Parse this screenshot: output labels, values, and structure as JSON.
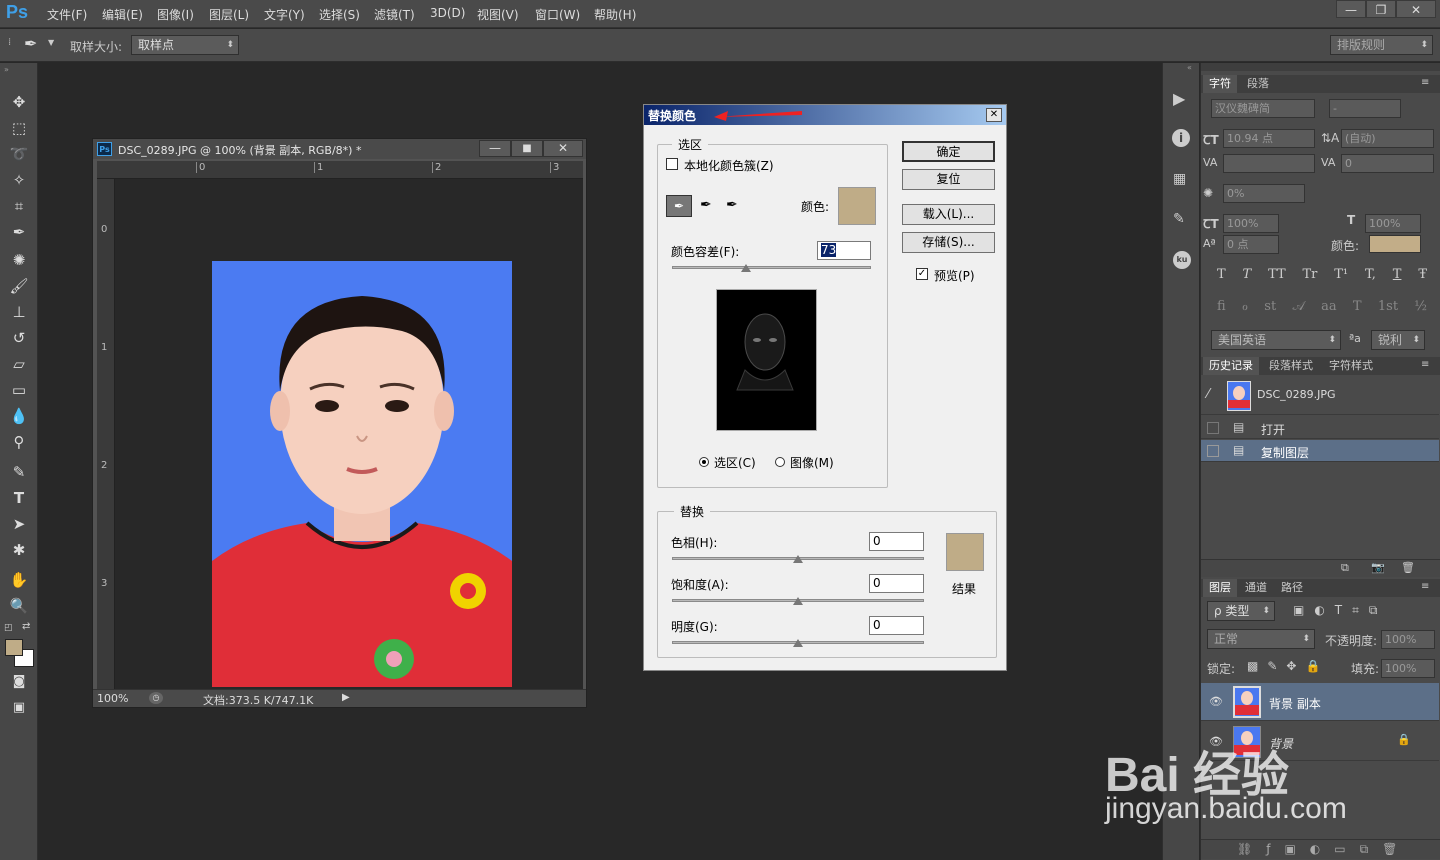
{
  "app": {
    "logo": "Ps"
  },
  "menu": [
    "文件(F)",
    "编辑(E)",
    "图像(I)",
    "图层(L)",
    "文字(Y)",
    "选择(S)",
    "滤镜(T)",
    "3D(D)",
    "视图(V)",
    "窗口(W)",
    "帮助(H)"
  ],
  "options": {
    "sample_size_label": "取样大小:",
    "sample_size_value": "取样点",
    "workspace": "排版规则"
  },
  "document": {
    "title": "DSC_0289.JPG @ 100% (背景 副本, RGB/8*) *",
    "zoom": "100%",
    "doc_info": "文档:373.5 K/747.1K",
    "ruler_h": [
      "0",
      "1",
      "2",
      "3"
    ],
    "ruler_v": [
      "0",
      "1",
      "2",
      "3"
    ]
  },
  "dialog": {
    "title": "替换颜色",
    "close": "✕",
    "selection_group": "选区",
    "localized": "本地化颜色簇(Z)",
    "color_label": "颜色:",
    "color_swatch": "#bfac87",
    "fuzziness_label": "颜色容差(F):",
    "fuzziness_value": "73",
    "fuzziness_fraction": 0.37,
    "radio_selection": "选区(C)",
    "radio_image": "图像(M)",
    "ok": "确定",
    "reset": "复位",
    "load": "载入(L)...",
    "save": "存储(S)...",
    "preview": "预览(P)",
    "replace_group": "替换",
    "hue_label": "色相(H):",
    "hue_value": "0",
    "sat_label": "饱和度(A):",
    "sat_value": "0",
    "light_label": "明度(G):",
    "light_value": "0",
    "result_label": "结果",
    "result_swatch": "#bfac87"
  },
  "char_panel": {
    "tabs": [
      "字符",
      "段落"
    ],
    "font_family": "汉仪魏碑简",
    "font_style": "-",
    "font_size": "10.94 点",
    "leading": "(自动)",
    "kerning": "",
    "tracking": "0",
    "scale_pct": "0%",
    "vscale": "100%",
    "hscale": "100%",
    "baseline": "0 点",
    "color_label": "颜色:",
    "text_color": "#c2ad88",
    "style_buttons": [
      "T",
      "T",
      "TT",
      "Tr",
      "T¹",
      "T,",
      "T",
      "Ŧ"
    ],
    "ot_buttons": [
      "fi",
      "ℴ",
      "st",
      "𝒜",
      "aa",
      "T",
      "1st",
      "½"
    ],
    "language": "美国英语",
    "aa_label": "ªa",
    "aa_value": "锐利"
  },
  "history_panel": {
    "tabs": [
      "历史记录",
      "段落样式",
      "字符样式"
    ],
    "snapshot": "DSC_0289.JPG",
    "items": [
      "打开",
      "复制图层"
    ]
  },
  "layers_panel": {
    "tabs": [
      "图层",
      "通道",
      "路径"
    ],
    "filter": "ρ 类型",
    "blend": "正常",
    "opacity_label": "不透明度:",
    "opacity": "100%",
    "lock_label": "锁定:",
    "fill_label": "填充:",
    "fill": "100%",
    "layers": [
      "背景 副本",
      "背景"
    ]
  },
  "watermark": {
    "brand": "Bai 经验",
    "url": "jingyan.baidu.com"
  }
}
